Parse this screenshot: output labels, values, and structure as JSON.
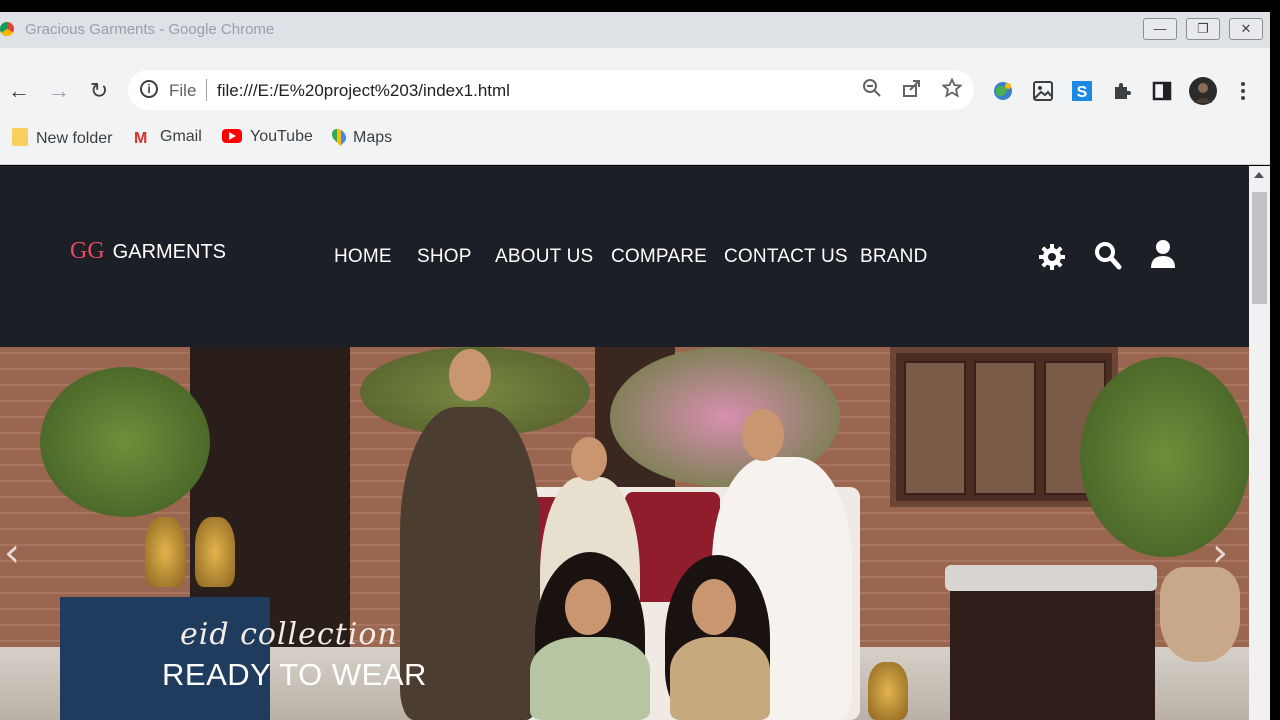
{
  "browser": {
    "window_title": "Gracious Garments - Google Chrome",
    "omnibox_scheme": "File",
    "url": "file:///E:/E%20project%203/index1.html",
    "bookmarks": [
      {
        "label": "New folder",
        "icon": "folder-icon"
      },
      {
        "label": "Gmail",
        "icon": "gmail-icon"
      },
      {
        "label": "YouTube",
        "icon": "youtube-icon"
      },
      {
        "label": "Maps",
        "icon": "maps-icon"
      }
    ]
  },
  "site": {
    "logo_mark": "GG",
    "logo_text": "GARMENTS",
    "nav": [
      {
        "label": "HOME"
      },
      {
        "label": "SHOP"
      },
      {
        "label": "ABOUT US"
      },
      {
        "label": "COMPARE"
      },
      {
        "label": "CONTACT US"
      },
      {
        "label": "BRAND"
      }
    ],
    "header_icons": [
      "settings-gear-icon",
      "search-icon",
      "user-icon"
    ],
    "hero": {
      "script_text": "eid collection",
      "headline": "READY TO WEAR",
      "prev_arrow": "‹",
      "next_arrow": "›"
    }
  },
  "colors": {
    "header_bg": "#1c1f26",
    "logo_accent": "#e84a5f",
    "nav_text": "#ffffff"
  }
}
